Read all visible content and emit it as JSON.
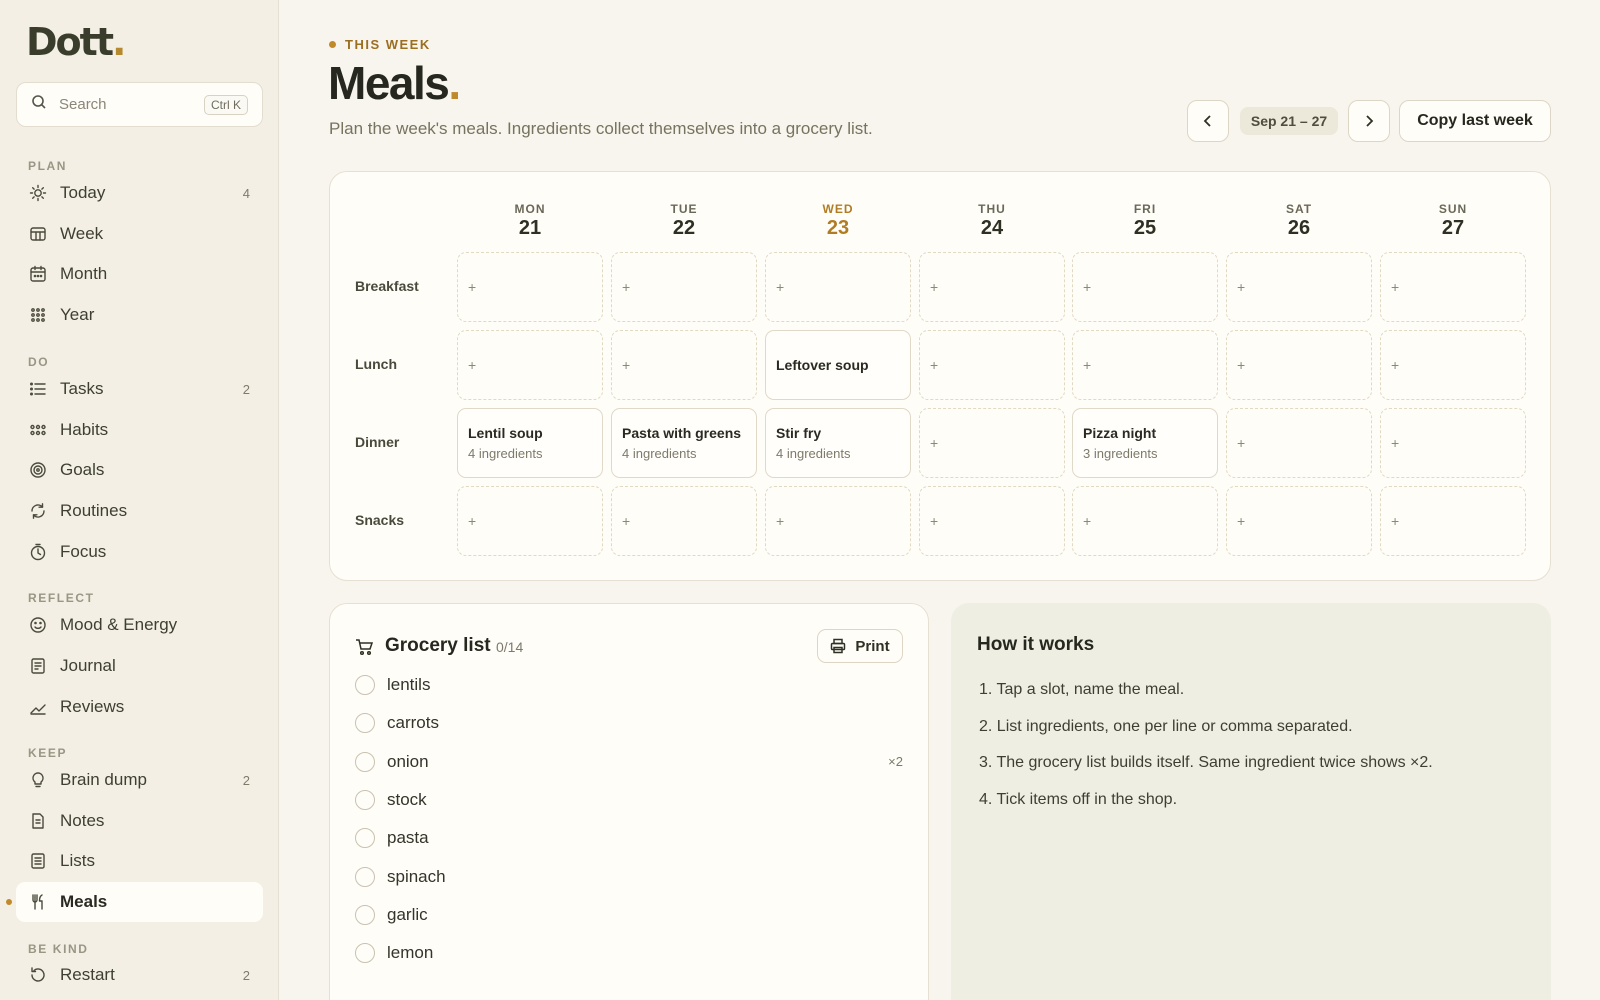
{
  "app": {
    "logo_text": "Dott",
    "logo_dot": "."
  },
  "search": {
    "placeholder": "Search",
    "shortcut": "Ctrl K"
  },
  "sidebar": {
    "sections": [
      {
        "label": "PLAN",
        "items": [
          {
            "label": "Today",
            "icon": "sun-icon",
            "count": "4"
          },
          {
            "label": "Week",
            "icon": "week-icon",
            "count": ""
          },
          {
            "label": "Month",
            "icon": "calendar-icon",
            "count": ""
          },
          {
            "label": "Year",
            "icon": "grid-icon",
            "count": ""
          }
        ]
      },
      {
        "label": "DO",
        "items": [
          {
            "label": "Tasks",
            "icon": "list-icon",
            "count": "2"
          },
          {
            "label": "Habits",
            "icon": "dots-icon",
            "count": ""
          },
          {
            "label": "Goals",
            "icon": "target-icon",
            "count": ""
          },
          {
            "label": "Routines",
            "icon": "refresh-icon",
            "count": ""
          },
          {
            "label": "Focus",
            "icon": "timer-icon",
            "count": ""
          }
        ]
      },
      {
        "label": "REFLECT",
        "items": [
          {
            "label": "Mood & Energy",
            "icon": "smile-icon",
            "count": ""
          },
          {
            "label": "Journal",
            "icon": "journal-icon",
            "count": ""
          },
          {
            "label": "Reviews",
            "icon": "trend-icon",
            "count": ""
          }
        ]
      },
      {
        "label": "KEEP",
        "items": [
          {
            "label": "Brain dump",
            "icon": "bulb-icon",
            "count": "2"
          },
          {
            "label": "Notes",
            "icon": "note-icon",
            "count": ""
          },
          {
            "label": "Lists",
            "icon": "lists-icon",
            "count": ""
          },
          {
            "label": "Meals",
            "icon": "utensils-icon",
            "count": "",
            "active": true
          }
        ]
      },
      {
        "label": "BE KIND",
        "items": [
          {
            "label": "Restart",
            "icon": "restart-icon",
            "count": "2"
          }
        ]
      }
    ]
  },
  "header": {
    "kicker": "THIS WEEK",
    "title": "Meals",
    "title_dot": ".",
    "subtitle": "Plan the week's meals. Ingredients collect themselves into a grocery list.",
    "range": "Sep 21 – 27",
    "copy_label": "Copy last week"
  },
  "planner": {
    "days": [
      {
        "name": "MON",
        "date": "21"
      },
      {
        "name": "TUE",
        "date": "22"
      },
      {
        "name": "WED",
        "date": "23",
        "today": true
      },
      {
        "name": "THU",
        "date": "24"
      },
      {
        "name": "FRI",
        "date": "25"
      },
      {
        "name": "SAT",
        "date": "26"
      },
      {
        "name": "SUN",
        "date": "27"
      }
    ],
    "empty_symbol": "+",
    "rows": [
      {
        "label": "Breakfast",
        "slots": [
          null,
          null,
          null,
          null,
          null,
          null,
          null
        ]
      },
      {
        "label": "Lunch",
        "slots": [
          null,
          null,
          {
            "meal": "Leftover soup",
            "ingredients": ""
          },
          null,
          null,
          null,
          null
        ]
      },
      {
        "label": "Dinner",
        "slots": [
          {
            "meal": "Lentil soup",
            "ingredients": "4 ingredients"
          },
          {
            "meal": "Pasta with greens",
            "ingredients": "4 ingredients"
          },
          {
            "meal": "Stir fry",
            "ingredients": "4 ingredients"
          },
          null,
          {
            "meal": "Pizza night",
            "ingredients": "3 ingredients"
          },
          null,
          null
        ]
      },
      {
        "label": "Snacks",
        "slots": [
          null,
          null,
          null,
          null,
          null,
          null,
          null
        ]
      }
    ]
  },
  "grocery": {
    "title": "Grocery list",
    "count": "0/14",
    "print_label": "Print",
    "items": [
      {
        "name": "lentils",
        "mult": ""
      },
      {
        "name": "carrots",
        "mult": ""
      },
      {
        "name": "onion",
        "mult": "×2"
      },
      {
        "name": "stock",
        "mult": ""
      },
      {
        "name": "pasta",
        "mult": ""
      },
      {
        "name": "spinach",
        "mult": ""
      },
      {
        "name": "garlic",
        "mult": ""
      },
      {
        "name": "lemon",
        "mult": ""
      }
    ]
  },
  "howto": {
    "title": "How it works",
    "steps": [
      "1. Tap a slot, name the meal.",
      "2. List ingredients, one per line or comma separated.",
      "3. The grocery list builds itself. Same ingredient twice shows ×2.",
      "4. Tick items off in the shop."
    ]
  },
  "colors": {
    "accent": "#c08a2c",
    "background": "#f8f5ee",
    "sidebar": "#f3efe4"
  }
}
